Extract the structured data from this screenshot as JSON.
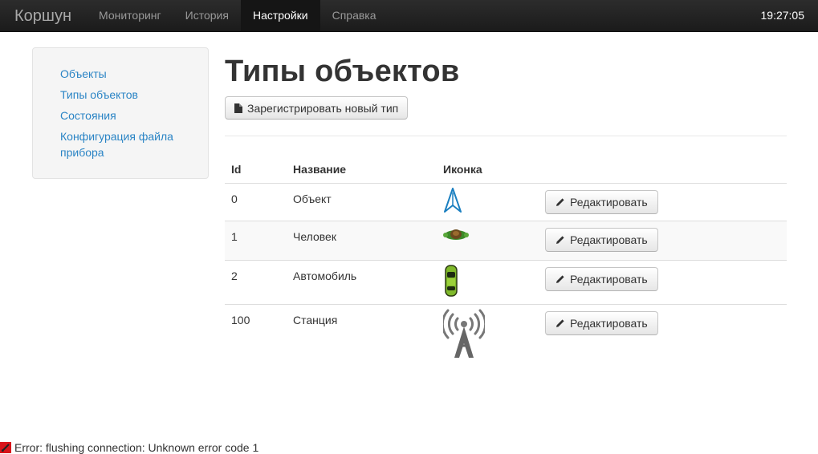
{
  "app": {
    "brand": "Коршун",
    "clock": "19:27:05"
  },
  "nav": {
    "items": [
      {
        "label": "Мониторинг",
        "active": false
      },
      {
        "label": "История",
        "active": false
      },
      {
        "label": "Настройки",
        "active": true
      },
      {
        "label": "Справка",
        "active": false
      }
    ]
  },
  "sidebar": {
    "items": [
      {
        "label": "Объекты"
      },
      {
        "label": "Типы объектов"
      },
      {
        "label": "Состояния"
      },
      {
        "label": "Конфигурация файла прибора"
      }
    ]
  },
  "main": {
    "title": "Типы объектов",
    "new_button_label": "Зарегистрировать новый тип",
    "columns": [
      "Id",
      "Название",
      "Иконка",
      ""
    ],
    "rows": [
      {
        "id": "0",
        "name": "Объект",
        "icon": "navigation-arrow-icon",
        "edit_label": "Редактировать"
      },
      {
        "id": "1",
        "name": "Человек",
        "icon": "turtle-icon",
        "edit_label": "Редактировать"
      },
      {
        "id": "2",
        "name": "Автомобиль",
        "icon": "car-topview-icon",
        "edit_label": "Редактировать"
      },
      {
        "id": "100",
        "name": "Станция",
        "icon": "radio-tower-icon",
        "edit_label": "Редактировать"
      }
    ]
  },
  "status": {
    "error_text": "Error: flushing connection: Unknown error code 1"
  },
  "colors": {
    "navbar": "#1b1b1b",
    "link": "#2a84c5",
    "error_icon": "#d8141a"
  }
}
